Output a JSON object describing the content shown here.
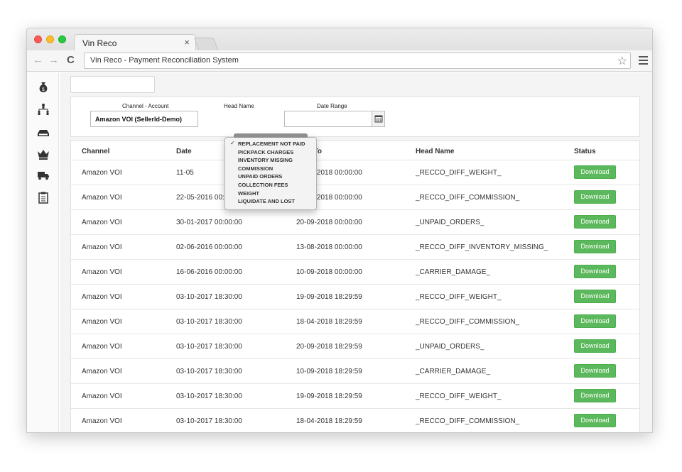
{
  "browser": {
    "tab_title": "Vin Reco",
    "tab_close": "×",
    "url": "Vin Reco - Payment Reconciliation System",
    "back": "←",
    "forward": "→",
    "reload": "C",
    "star": "☆"
  },
  "sidebar": {
    "icons": [
      "money-bag-icon",
      "hierarchy-icon",
      "drive-icon",
      "crown-icon",
      "truck-icon",
      "clipboard-icon"
    ]
  },
  "filters": {
    "channel_label": "Channel - Account",
    "channel_value": "Amazon VOI (SellerId-Demo)",
    "head_label": "Head Name",
    "date_label": "Date Range"
  },
  "dropdown": {
    "check": "✓",
    "items": [
      "REPLACEMENT NOT PAID",
      "PICKPACK CHARGES",
      "INVENTORY MISSING",
      "COMMISSION",
      "UNPAID ORDERS",
      "COLLECTION FEES",
      "WEIGHT",
      "LIQUIDATE AND LOST"
    ]
  },
  "table": {
    "headers": [
      "Channel",
      "Date",
      "Date To",
      "Head Name",
      "Status"
    ],
    "rows": [
      {
        "channel": "Amazon VOI",
        "from": "11-05",
        "to": "19-09-2018 00:00:00",
        "head": "_RECCO_DIFF_WEIGHT_",
        "status": "Download"
      },
      {
        "channel": "Amazon VOI",
        "from": "22-05-2016 00:00:00",
        "to": "18-04-2018 00:00:00",
        "head": "_RECCO_DIFF_COMMISSION_",
        "status": "Download"
      },
      {
        "channel": "Amazon VOI",
        "from": "30-01-2017 00:00:00",
        "to": "20-09-2018 00:00:00",
        "head": "_UNPAID_ORDERS_",
        "status": "Download"
      },
      {
        "channel": "Amazon VOI",
        "from": "02-06-2016 00:00:00",
        "to": "13-08-2018 00:00:00",
        "head": "_RECCO_DIFF_INVENTORY_MISSING_",
        "status": "Download"
      },
      {
        "channel": "Amazon VOI",
        "from": "16-06-2016 00:00:00",
        "to": "10-09-2018 00:00:00",
        "head": "_CARRIER_DAMAGE_",
        "status": "Download"
      },
      {
        "channel": "Amazon VOI",
        "from": "03-10-2017 18:30:00",
        "to": "19-09-2018 18:29:59",
        "head": "_RECCO_DIFF_WEIGHT_",
        "status": "Download"
      },
      {
        "channel": "Amazon VOI",
        "from": "03-10-2017 18:30:00",
        "to": "18-04-2018 18:29:59",
        "head": "_RECCO_DIFF_COMMISSION_",
        "status": "Download"
      },
      {
        "channel": "Amazon VOI",
        "from": "03-10-2017 18:30:00",
        "to": "20-09-2018 18:29:59",
        "head": "_UNPAID_ORDERS_",
        "status": "Download"
      },
      {
        "channel": "Amazon VOI",
        "from": "03-10-2017 18:30:00",
        "to": "10-09-2018 18:29:59",
        "head": "_CARRIER_DAMAGE_",
        "status": "Download"
      },
      {
        "channel": "Amazon VOI",
        "from": "03-10-2017 18:30:00",
        "to": "19-09-2018 18:29:59",
        "head": "_RECCO_DIFF_WEIGHT_",
        "status": "Download"
      },
      {
        "channel": "Amazon VOI",
        "from": "03-10-2017 18:30:00",
        "to": "18-04-2018 18:29:59",
        "head": "_RECCO_DIFF_COMMISSION_",
        "status": "Download"
      }
    ]
  },
  "colors": {
    "download_button": "#5cb85c",
    "icon": "#333333"
  }
}
